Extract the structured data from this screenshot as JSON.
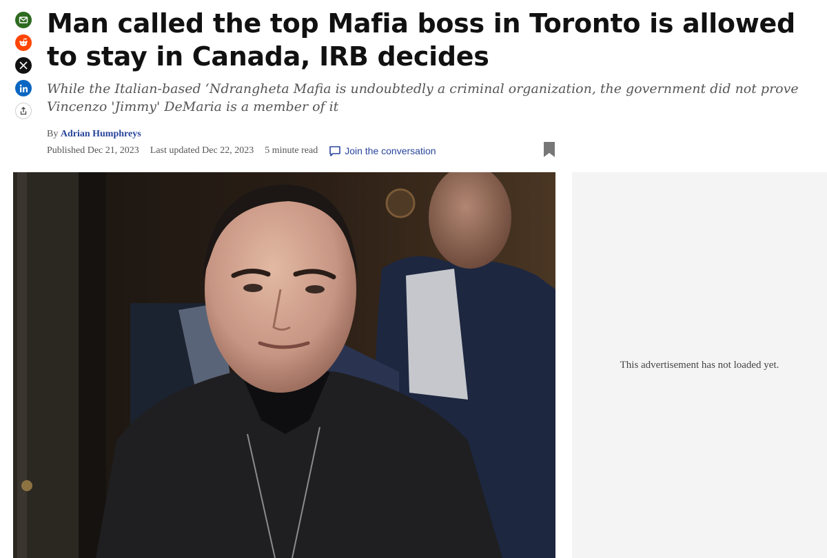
{
  "article": {
    "headline": "Man called the top Mafia boss in Toronto is allowed to stay in Canada, IRB decides",
    "deck": "While the Italian-based ‘Ndrangheta Mafia is undoubtedly a criminal organization, the government did not prove Vincenzo 'Jimmy' DeMaria is a member of it",
    "byline_prefix": "By",
    "author": "Adrian Humphreys",
    "published": "Published Dec 21, 2023",
    "updated": "Last updated Dec 22, 2023",
    "read_time": "5 minute read",
    "join_label": "Join the conversation"
  },
  "share": [
    "email-icon",
    "reddit-icon",
    "x-icon",
    "linkedin-icon",
    "share-icon"
  ],
  "ad": {
    "message": "This advertisement has not loaded yet."
  },
  "colors": {
    "link": "#27449b",
    "email": "#2e6b1f",
    "reddit": "#ff4500",
    "x": "#111111",
    "linkedin": "#0a66c2",
    "ad_background": "#f4f4f4"
  }
}
